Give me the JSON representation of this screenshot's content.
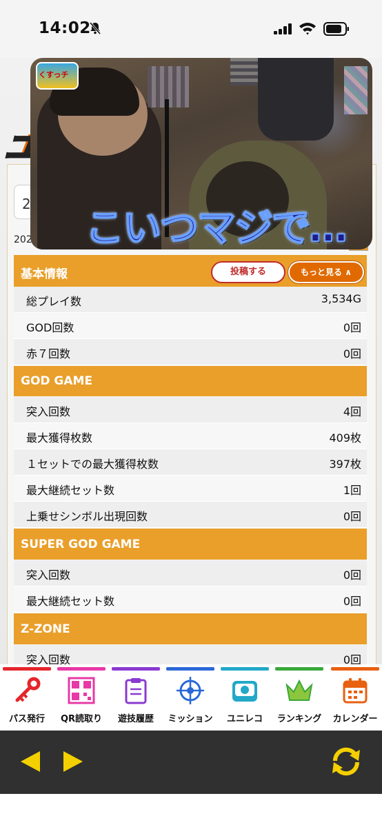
{
  "status": {
    "time": "14:02"
  },
  "page": {
    "date_select": "2",
    "date_text": "2026/"
  },
  "video": {
    "caption": "こいつマジで…",
    "badge": "くすっチ"
  },
  "basic": {
    "title": "基本情報",
    "post_button": "投稿する",
    "more_button": "もっと見る ∧",
    "rows": [
      {
        "label": "総プレイ数",
        "value": "3,534G"
      },
      {
        "label": "GOD回数",
        "value": "0回"
      },
      {
        "label": "赤７回数",
        "value": "0回"
      }
    ]
  },
  "god_game": {
    "title": "GOD GAME",
    "rows": [
      {
        "label": "突入回数",
        "value": "4回"
      },
      {
        "label": "最大獲得枚数",
        "value": "409枚"
      },
      {
        "label": "１セットでの最大獲得枚数",
        "value": "397枚"
      },
      {
        "label": "最大継続セット数",
        "value": "1回"
      },
      {
        "label": "上乗せシンボル出現回数",
        "value": "0回"
      }
    ]
  },
  "super_god_game": {
    "title": "SUPER GOD GAME",
    "rows": [
      {
        "label": "突入回数",
        "value": "0回"
      },
      {
        "label": "最大継続セット数",
        "value": "0回"
      }
    ]
  },
  "z_zone": {
    "title": "Z-ZONE",
    "rows": [
      {
        "label": "突入回数",
        "value": "0回"
      }
    ]
  },
  "nav": [
    {
      "label": "パス発行",
      "color": "#e4262b",
      "icon": "key-icon"
    },
    {
      "label": "QR読取り",
      "color": "#e73aa6",
      "icon": "qr-code-icon"
    },
    {
      "label": "遊技履歴",
      "color": "#8a3ad0",
      "icon": "clipboard-icon"
    },
    {
      "label": "ミッション",
      "color": "#2a68d8",
      "icon": "target-icon"
    },
    {
      "label": "ユニレコ",
      "color": "#22a8c8",
      "icon": "unireco-icon"
    },
    {
      "label": "ランキング",
      "color": "#3aa83a",
      "icon": "crown-icon"
    },
    {
      "label": "カレンダー",
      "color": "#e86010",
      "icon": "calendar-icon"
    }
  ]
}
